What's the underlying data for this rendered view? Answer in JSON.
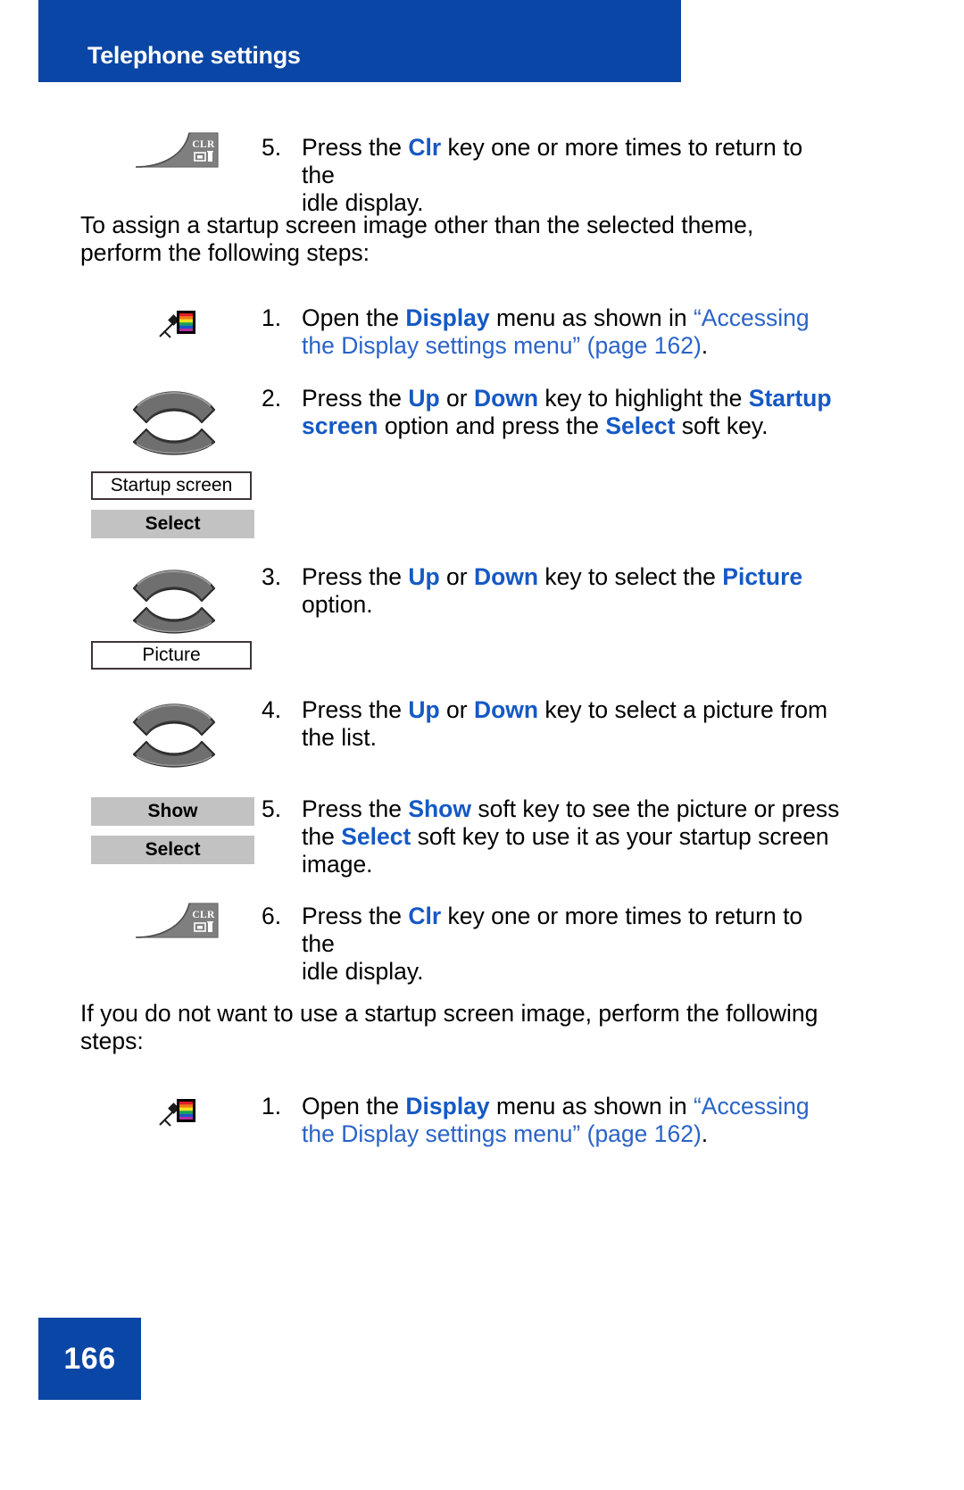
{
  "header": {
    "title": "Telephone settings"
  },
  "paragraphs": {
    "intro_assign": "To assign a startup screen image other than the selected theme, perform the following steps:",
    "intro_no_image": "If you do not want to use a startup screen image, perform the following steps:"
  },
  "steps": [
    {
      "number": "5.",
      "icon": "clr-key-icon",
      "segments": [
        {
          "text": "Press the ",
          "style": "normal"
        },
        {
          "text": "Clr",
          "style": "blue-bold"
        },
        {
          "text": " key one or more times to return to the idle display.",
          "style": "normal"
        }
      ]
    },
    {
      "number": "1.",
      "icon": "display-palette-icon",
      "segments": [
        {
          "text": "Open the ",
          "style": "normal"
        },
        {
          "text": "Display",
          "style": "blue-bold"
        },
        {
          "text": " menu as shown in ",
          "style": "normal"
        },
        {
          "text": "“Accessing the Display settings menu” (page 162)",
          "style": "link"
        },
        {
          "text": ".",
          "style": "normal"
        }
      ]
    },
    {
      "number": "2.",
      "icon": "updown-nav-key-icon",
      "segments": [
        {
          "text": "Press the ",
          "style": "normal"
        },
        {
          "text": "Up",
          "style": "blue-bold"
        },
        {
          "text": " or ",
          "style": "normal"
        },
        {
          "text": "Down",
          "style": "blue-bold"
        },
        {
          "text": " key to highlight the ",
          "style": "normal"
        },
        {
          "text": "Startup screen",
          "style": "blue-bold"
        },
        {
          "text": " option and press the ",
          "style": "normal"
        },
        {
          "text": "Select",
          "style": "blue-bold"
        },
        {
          "text": " soft key.",
          "style": "normal"
        }
      ]
    },
    {
      "number": "3.",
      "icon": "updown-nav-key-icon",
      "segments": [
        {
          "text": "Press the ",
          "style": "normal"
        },
        {
          "text": "Up",
          "style": "blue-bold"
        },
        {
          "text": " or ",
          "style": "normal"
        },
        {
          "text": "Down",
          "style": "blue-bold"
        },
        {
          "text": " key to select the ",
          "style": "normal"
        },
        {
          "text": "Picture",
          "style": "blue-bold"
        },
        {
          "text": " option.",
          "style": "normal"
        }
      ]
    },
    {
      "number": "4.",
      "icon": "updown-nav-key-icon",
      "segments": [
        {
          "text": "Press the ",
          "style": "normal"
        },
        {
          "text": "Up",
          "style": "blue-bold"
        },
        {
          "text": " or ",
          "style": "normal"
        },
        {
          "text": "Down",
          "style": "blue-bold"
        },
        {
          "text": " key to select a picture from the list.",
          "style": "normal"
        }
      ]
    },
    {
      "number": "5.",
      "icon": "softkey-pair",
      "segments": [
        {
          "text": "Press the ",
          "style": "normal"
        },
        {
          "text": "Show",
          "style": "blue-bold"
        },
        {
          "text": " soft key to see the picture or press the ",
          "style": "normal"
        },
        {
          "text": "Select",
          "style": "blue-bold"
        },
        {
          "text": " soft key to use it as your startup screen image.",
          "style": "normal"
        }
      ]
    },
    {
      "number": "6.",
      "icon": "clr-key-icon",
      "segments": [
        {
          "text": "Press the ",
          "style": "normal"
        },
        {
          "text": "Clr",
          "style": "blue-bold"
        },
        {
          "text": " key one or more times to return to the idle display.",
          "style": "normal"
        }
      ]
    },
    {
      "number": "1.",
      "icon": "display-palette-icon",
      "segments": [
        {
          "text": "Open the ",
          "style": "normal"
        },
        {
          "text": "Display",
          "style": "blue-bold"
        },
        {
          "text": " menu as shown in ",
          "style": "normal"
        },
        {
          "text": "“Accessing the Display settings menu” (page 162)",
          "style": "link"
        },
        {
          "text": ".",
          "style": "normal"
        }
      ]
    }
  ],
  "step_text_lines": {
    "s5a_line1_pre": "Press the ",
    "s5a_key": "Clr",
    "s5a_line1_post": " key one or more times to return to the",
    "s5a_line2": "idle display.",
    "s1a_pre": "Open the ",
    "s1a_bold": "Display",
    "s1a_mid": " menu as shown in ",
    "s1a_link1": "“Accessing",
    "s1a_link2": "the Display settings menu” (page 162)",
    "s1a_end": ".",
    "s2_pre": "Press the ",
    "s2_up": "Up",
    "s2_or": " or ",
    "s2_down": "Down",
    "s2_mid": " key to highlight the ",
    "s2_opt1": "Startup",
    "s2_opt2": "screen",
    "s2_mid2": " option and press the ",
    "s2_select": "Select",
    "s2_end": " soft key.",
    "s3_pre": "Press the ",
    "s3_up": "Up",
    "s3_or": " or ",
    "s3_down": "Down",
    "s3_mid": " key to select the ",
    "s3_opt": "Picture",
    "s3_end": "option.",
    "s4_pre": "Press the ",
    "s4_up": "Up",
    "s4_or": " or ",
    "s4_down": "Down",
    "s4_mid": " key to select a picture from",
    "s4_end": "the list.",
    "s5b_pre": "Press the ",
    "s5b_show": "Show",
    "s5b_mid": " soft key to see the picture or press",
    "s5b_the": "the ",
    "s5b_select": "Select",
    "s5b_mid2": " soft key to use it as your startup screen",
    "s5b_end": "image.",
    "s6_pre": "Press the ",
    "s6_key": "Clr",
    "s6_post": " key one or more times to return to the",
    "s6_line2": "idle display.",
    "s1b_pre": "Open the ",
    "s1b_bold": "Display",
    "s1b_mid": " menu as shown in ",
    "s1b_link1": "“Accessing",
    "s1b_link2": "the Display settings menu” (page 162)",
    "s1b_end": "."
  },
  "step_numbers": {
    "n5a": "5.",
    "n1a": "1.",
    "n2": "2.",
    "n3": "3.",
    "n4": "4.",
    "n5b": "5.",
    "n6": "6.",
    "n1b": "1."
  },
  "menu_items": {
    "startup_screen": "Startup screen",
    "picture": "Picture"
  },
  "soft_keys": {
    "select_1": "Select",
    "show": "Show",
    "select_2": "Select"
  },
  "icons": {
    "clr_label": "CLR",
    "clr_name": "clr-key-icon",
    "display_name": "display-palette-icon",
    "navkey_name": "updown-nav-key-icon"
  },
  "footer": {
    "page_number": "166"
  },
  "colors": {
    "header_blue": "#0a46a5",
    "link_blue": "#2a63c8",
    "keyword_blue": "#1559c4",
    "softkey_gray": "#c2c2c2",
    "key_gray": "#7f7f7f",
    "menu_border": "#3f3536"
  }
}
